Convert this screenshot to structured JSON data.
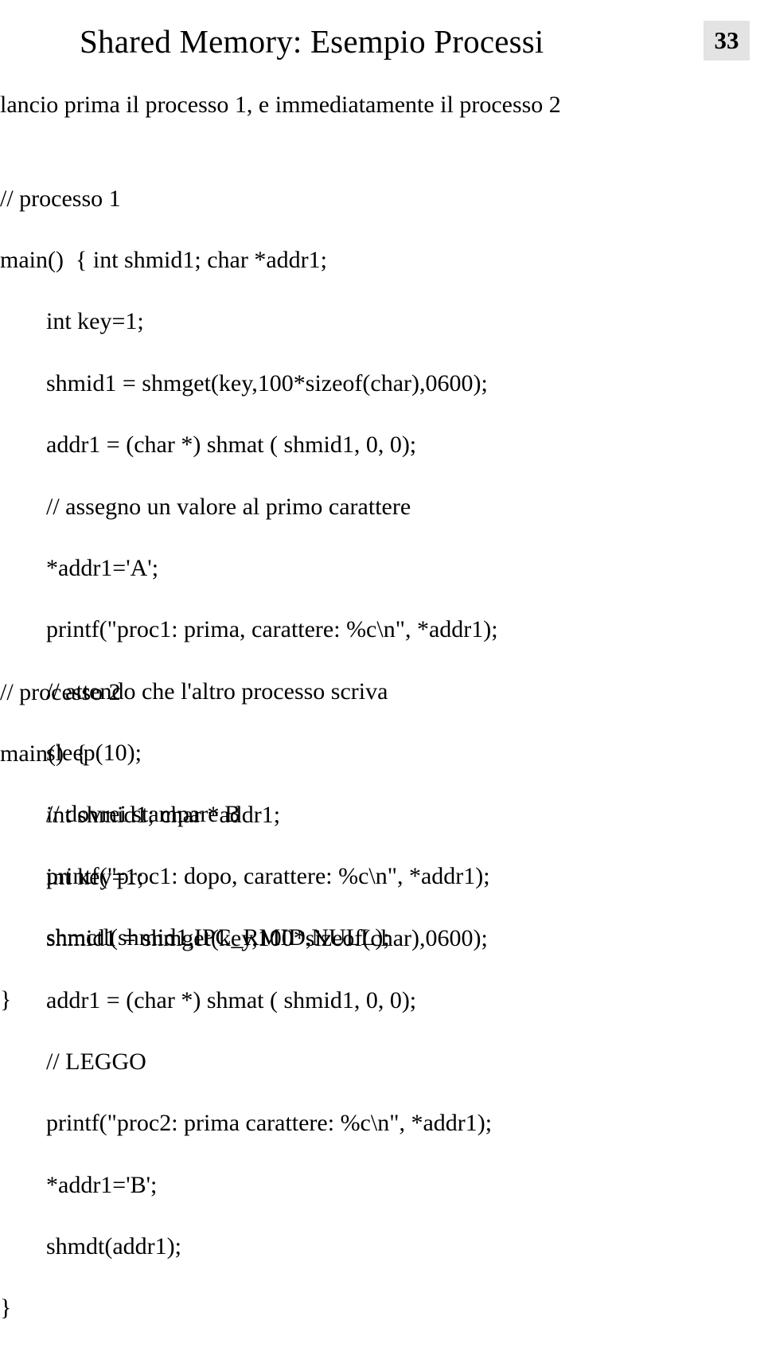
{
  "page_number": "33",
  "title": "Shared Memory:  Esempio Processi",
  "intro": "lancio prima il processo 1, e immediatamente il processo 2",
  "proc1": {
    "l1": "// processo 1",
    "l2": "main()  { int shmid1; char *addr1;",
    "l3": "int key=1;",
    "l4": "shmid1 = shmget(key,100*sizeof(char),0600);",
    "l5": "addr1 = (char *) shmat ( shmid1, 0, 0);",
    "l6": "// assegno un valore al primo carattere",
    "l7": "*addr1='A';",
    "l8": "printf(\"proc1: prima, carattere: %c\\n\", *addr1);",
    "l9": "// attendo che l'altro processo scriva",
    "l10": "sleep(10);",
    "l11": "// dovrei stampare B",
    "l12": "printf(\"proc1: dopo, carattere: %c\\n\", *addr1);",
    "l13": "shmctl(shmid1,IPC_RMID,NULL);",
    "l14": "}"
  },
  "proc2": {
    "l1": "// processo 2",
    "l2": "main()  {",
    "l3": "int shmid1; char *addr1;",
    "l4": "int key=1;",
    "l5": "shmid1 = shmget(key,100*sizeof(char),0600);",
    "l6": "addr1 = (char *) shmat ( shmid1, 0, 0);",
    "l7": "// LEGGO",
    "l8": "printf(\"proc2: prima carattere: %c\\n\", *addr1);",
    "l9": "*addr1='B';",
    "l10": "shmdt(addr1);",
    "l11": "}"
  }
}
